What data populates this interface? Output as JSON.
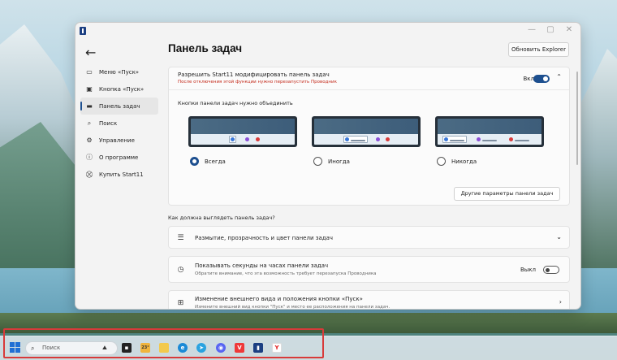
{
  "window": {
    "title": "",
    "back_icon": "arrow-left-icon",
    "refresh_button": "Обновить Explorer",
    "page_title": "Панель задач"
  },
  "sidebar": {
    "items": [
      {
        "label": "Меню «Пуск»",
        "icon": "start-menu-icon"
      },
      {
        "label": "Кнопка «Пуск»",
        "icon": "start-button-icon"
      },
      {
        "label": "Панель задач",
        "icon": "taskbar-icon",
        "active": true
      },
      {
        "label": "Поиск",
        "icon": "search-icon"
      },
      {
        "label": "Управление",
        "icon": "gear-icon"
      },
      {
        "label": "О программе",
        "icon": "info-icon"
      },
      {
        "label": "Купить Start11",
        "icon": "cart-icon"
      }
    ]
  },
  "main": {
    "allow_card": {
      "title": "Разрешить Start11 модифицировать панель задач",
      "warning": "После отключения этой функции нужно перезапустить Проводник",
      "toggle_label": "Вкл",
      "toggle_on": true
    },
    "combine": {
      "label": "Кнопки панели задач нужно объединить",
      "options": [
        {
          "label": "Всегда",
          "checked": true
        },
        {
          "label": "Иногда",
          "checked": false
        },
        {
          "label": "Никогда",
          "checked": false
        }
      ],
      "other_button": "Другие параметры панели задач"
    },
    "section_heading": "Как должна выглядеть панель задач?",
    "rows": [
      {
        "title": "Размытие, прозрачность и цвет панели задач",
        "subtitle": ""
      },
      {
        "title": "Показывать секунды на часах панели задач",
        "subtitle": "Обратите внимание, что эта возможность требует перезапуска Проводника",
        "toggle_label": "Выкл",
        "toggle_on": false
      },
      {
        "title": "Изменение внешнего вида и положения кнопки «Пуск»",
        "subtitle": "Измените внешний вид кнопки \"Пуск\" и место ее расположения на панели задач."
      }
    ]
  },
  "taskbar": {
    "search_placeholder": "Поиск",
    "weather_temp": "23°",
    "apps": [
      "task-view-icon",
      "weather-icon",
      "file-explorer-icon",
      "edge-icon",
      "telegram-icon",
      "discord-icon",
      "vivaldi-icon",
      "start11-icon",
      "yandex-browser-icon"
    ]
  }
}
